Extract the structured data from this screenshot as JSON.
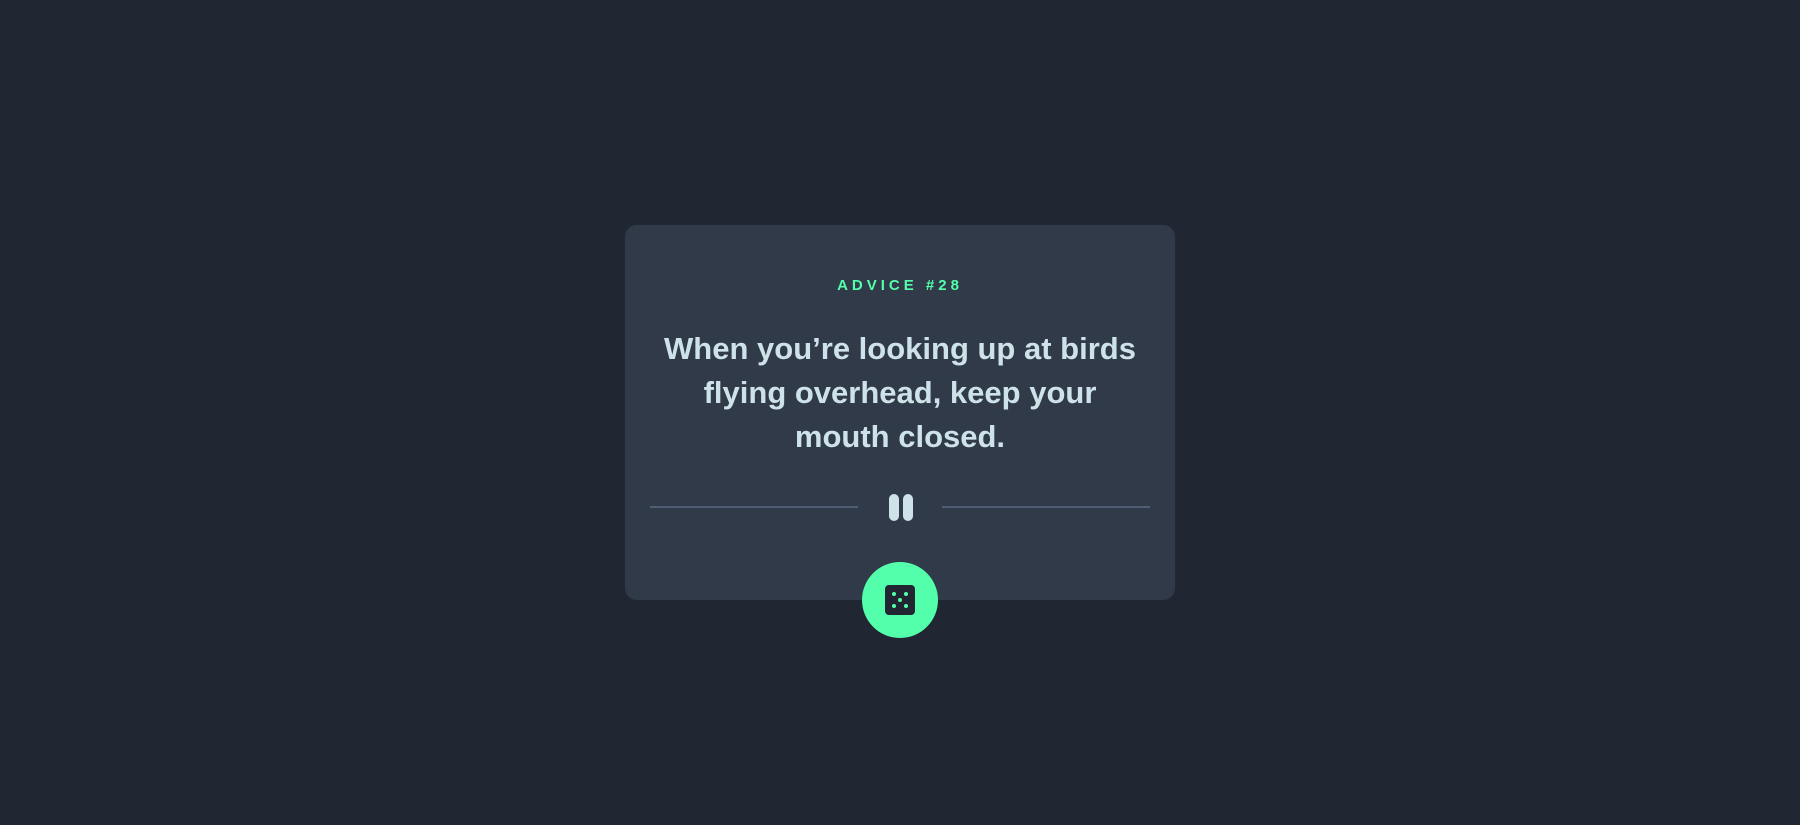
{
  "advice": {
    "label": "ADVICE #28",
    "quote": "When you’re looking up at birds flying overhead, keep your mouth closed."
  },
  "icons": {
    "divider": "pause-divider-icon",
    "button": "dice-icon"
  },
  "colors": {
    "background": "#202733",
    "card": "#313a48",
    "accent": "#53ffaa",
    "text": "#cee3e9",
    "divider_line": "#4f5d74"
  }
}
